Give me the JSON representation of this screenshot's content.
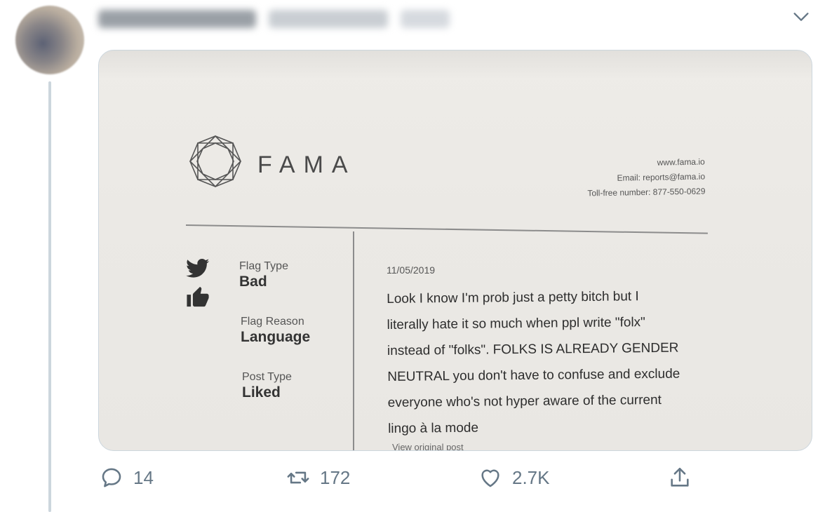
{
  "tweet": {
    "avatar_icon": "avatar-blurred",
    "menu_icon": "chevron-down-icon"
  },
  "media": {
    "brand": "FAMA",
    "contact": {
      "website": "www.fama.io",
      "email": "Email: reports@fama.io",
      "phone": "Toll-free number: 877-550-0629"
    },
    "icons": [
      "twitter-bird-icon",
      "thumbs-up-icon"
    ],
    "fields": [
      {
        "label": "Flag Type",
        "value": "Bad"
      },
      {
        "label": "Flag Reason",
        "value": "Language"
      },
      {
        "label": "Post Type",
        "value": "Liked"
      }
    ],
    "post_date": "11/05/2019",
    "post_lines": [
      "Look I know I'm prob just a petty bitch but I",
      "literally hate it so much when ppl write \"folx\"",
      "instead of \"folks\". FOLKS IS ALREADY GENDER",
      "NEUTRAL you don't have to confuse and exclude",
      "everyone who's not hyper aware of the current",
      "lingo à la mode"
    ],
    "view_original": "View original post"
  },
  "actions": {
    "reply_count": "14",
    "retweet_count": "172",
    "like_count": "2.7K"
  },
  "colors": {
    "icon_gray": "#657786",
    "thread_line": "#ccd6dd",
    "border": "#ccd6dd"
  }
}
